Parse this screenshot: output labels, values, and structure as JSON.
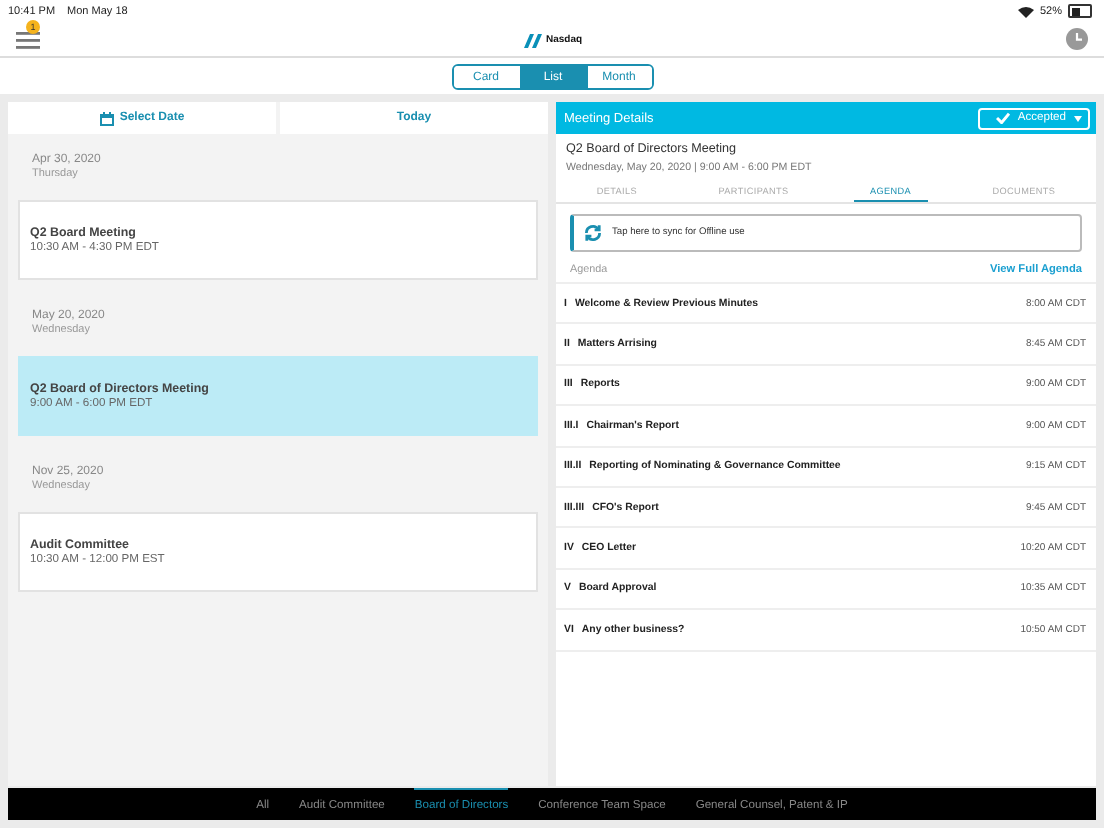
{
  "status_bar": {
    "time": "10:41 PM",
    "date": "Mon May 18",
    "battery": "52%"
  },
  "header": {
    "notification_badge": "1",
    "logo_text": "Nasdaq"
  },
  "view_switch": [
    {
      "label": "Card",
      "selected": false
    },
    {
      "label": "List",
      "selected": true
    },
    {
      "label": "Month",
      "selected": false
    }
  ],
  "left": {
    "select_date": "Select Date",
    "today": "Today",
    "groups": [
      {
        "date": "Apr 30, 2020",
        "weekday": "Thursday",
        "meetings": [
          {
            "title": "Q2 Board Meeting",
            "time": "10:30 AM - 4:30 PM EDT",
            "selected": false
          }
        ]
      },
      {
        "date": "May 20, 2020",
        "weekday": "Wednesday",
        "meetings": [
          {
            "title": "Q2 Board of Directors Meeting",
            "time": "9:00 AM - 6:00 PM EDT",
            "selected": true
          }
        ]
      },
      {
        "date": "Nov 25, 2020",
        "weekday": "Wednesday",
        "meetings": [
          {
            "title": "Audit Committee",
            "time": "10:30 AM - 12:00 PM EST",
            "selected": false
          }
        ]
      }
    ]
  },
  "details": {
    "title": "Meeting Details",
    "response": "Accepted",
    "meeting_title": "Q2 Board of Directors Meeting",
    "meeting_subtitle": "Wednesday, May 20, 2020 | 9:00 AM - 6:00 PM EDT",
    "tabs": [
      {
        "label": "DETAILS",
        "selected": false
      },
      {
        "label": "PARTICIPANTS",
        "selected": false
      },
      {
        "label": "AGENDA",
        "selected": true
      },
      {
        "label": "DOCUMENTS",
        "selected": false
      }
    ],
    "sync_text": "Tap here to sync for Offline use",
    "agenda_label": "Agenda",
    "view_full": "View Full Agenda",
    "items": [
      {
        "number": "I",
        "title": "Welcome & Review Previous Minutes",
        "time": "8:00 AM CDT"
      },
      {
        "number": "II",
        "title": "Matters Arrising",
        "time": "8:45 AM CDT"
      },
      {
        "number": "III",
        "title": "Reports",
        "time": "9:00 AM CDT"
      },
      {
        "number": "III.I",
        "title": "Chairman's Report",
        "time": "9:00 AM CDT"
      },
      {
        "number": "III.II",
        "title": "Reporting of Nominating & Governance Committee",
        "time": "9:15 AM CDT"
      },
      {
        "number": "III.III",
        "title": "CFO's Report",
        "time": "9:45 AM CDT"
      },
      {
        "number": "IV",
        "title": "CEO Letter",
        "time": "10:20 AM CDT"
      },
      {
        "number": "V",
        "title": "Board Approval",
        "time": "10:35 AM CDT"
      },
      {
        "number": "VI",
        "title": "Any other business?",
        "time": "10:50 AM CDT"
      }
    ]
  },
  "bottom_tabs": [
    {
      "label": "All",
      "selected": false
    },
    {
      "label": "Audit Committee",
      "selected": false
    },
    {
      "label": "Board of Directors",
      "selected": true
    },
    {
      "label": "Conference Team Space",
      "selected": false
    },
    {
      "label": "General Counsel, Patent & IP",
      "selected": false
    }
  ]
}
